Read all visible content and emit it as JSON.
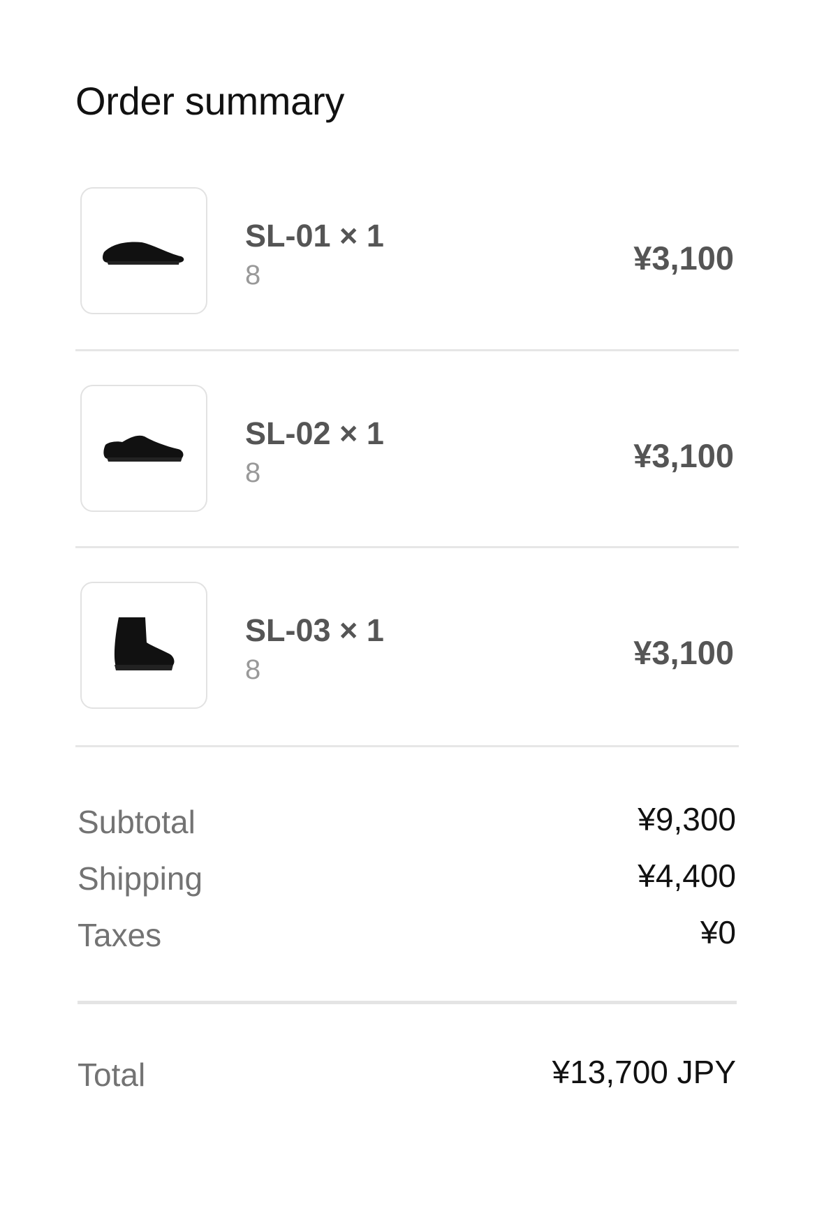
{
  "title": "Order summary",
  "items": [
    {
      "name": "SL-01 × 1",
      "variant": "8",
      "price": "¥3,100",
      "icon": "slip-on-shoe-icon"
    },
    {
      "name": "SL-02 × 1",
      "variant": "8",
      "price": "¥3,100",
      "icon": "low-shoe-icon"
    },
    {
      "name": "SL-03 × 1",
      "variant": "8",
      "price": "¥3,100",
      "icon": "boot-icon"
    }
  ],
  "summary": {
    "subtotal_label": "Subtotal",
    "subtotal_value": "¥9,300",
    "shipping_label": "Shipping",
    "shipping_value": "¥4,400",
    "taxes_label": "Taxes",
    "taxes_value": "¥0"
  },
  "total": {
    "label": "Total",
    "value": "¥13,700 JPY"
  }
}
